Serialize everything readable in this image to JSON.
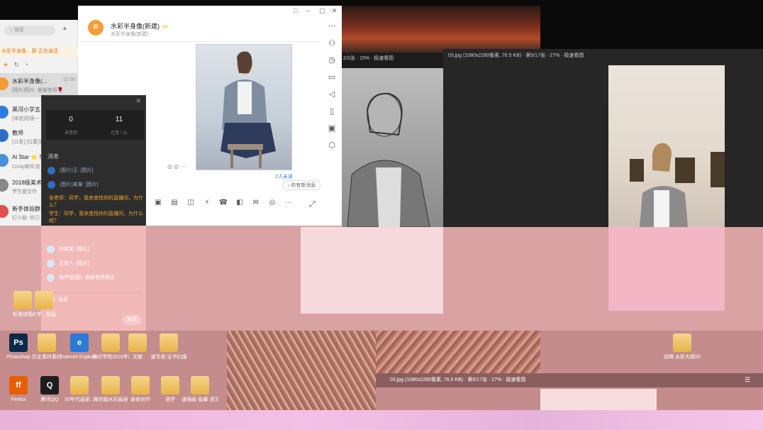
{
  "chat_list": {
    "search_placeholder": "搜索",
    "add_label": "+",
    "notice": "水彩半身像... 群 正在通话",
    "items": [
      {
        "name": "水彩半身像(...",
        "badge": "VIP",
        "message": "[图片]图片: 谢谢老师🌹",
        "time": "11:06",
        "color": "#f29d38"
      },
      {
        "name": "黑河小学五",
        "message": "[体验]班级一",
        "time": "",
        "color": "#2d7be0"
      },
      {
        "name": "教师",
        "message": "[11条] [位置]班",
        "time": "",
        "color": "#2d6dc4"
      },
      {
        "name": "Ai Star ⭐ S",
        "message": "Cindy邮件测",
        "time": "",
        "color": "#4a90d9"
      },
      {
        "name": "2018级美术",
        "message": "学生提交作",
        "time": "",
        "color": "#888888"
      },
      {
        "name": "新手体验群",
        "message": "钉小秘: 你已",
        "time": "",
        "color": "#e05050"
      }
    ]
  },
  "chat_window": {
    "group_avatar": "群",
    "group_title": "水彩半身像(新建)",
    "group_badge": "VIP",
    "group_subtitle": "水彩半身像(新建)",
    "window_controls": {
      "pin": "□",
      "minimize": "–",
      "maximize": "▢",
      "close": "✕"
    },
    "message_controls": "◎ ◎ ···",
    "unread_count": "2人未读",
    "new_message_button": "↓ 你有新消息"
  },
  "popup": {
    "close": "✕",
    "stats": [
      {
        "value": "0",
        "label": "未签到"
      },
      {
        "value": "11",
        "label": "已签 / 11"
      }
    ],
    "section_label": "消息",
    "rows": [
      {
        "name": "(图片)王: [图片]"
      },
      {
        "name": "(图片)某某: [图片]"
      }
    ],
    "warnings": [
      "张老师：同学，我来查找你的直播间，为什么？",
      "学生：同学，我来查找你的直播间，为什么呢？"
    ],
    "pink_rows": [
      {
        "name": "刘某某: [图片]"
      },
      {
        "name": "主持人: [图片]"
      },
      {
        "name": "同学(回复): 谢谢老师指点"
      }
    ],
    "reply_placeholder": "回复: 消息",
    "send_button": "发送"
  },
  "viewer1": {
    "title": "2/2张 · 15% · 极速看图",
    "filename": "",
    "zoom": "15%"
  },
  "viewer2": {
    "title": "03.jpg (1080x2280像素, 76.5 KB) · 第5/17张 · 27% · 极速看图"
  },
  "viewer3": {
    "title": "03.jpg (1080x2280像素, 76.5 KB) · 第5/17张 · 27% · 极速看图"
  },
  "desktop_icons": [
    {
      "label": "标准讲图",
      "color": "#e8b44a",
      "glyph": ""
    },
    {
      "label": "大学 · 绘画",
      "color": "#e8b44a",
      "glyph": ""
    },
    {
      "label": "Photoshop",
      "color": "#0b2a4a",
      "glyph": "Ps"
    },
    {
      "label": "历史素材素材",
      "color": "#e8b44a",
      "glyph": ""
    },
    {
      "label": "Internet Explorer",
      "color": "#2a7ad6",
      "glyph": "e"
    },
    {
      "label": "黑河学院2019年画...",
      "color": "#f0f0f0",
      "glyph": ""
    },
    {
      "label": "文献",
      "color": "#e8b44a",
      "glyph": ""
    },
    {
      "label": "速写册 证书扫描",
      "color": "#e8b44a",
      "glyph": ""
    },
    {
      "label": "Firefox",
      "color": "#e66000",
      "glyph": "ff"
    },
    {
      "label": "腾讯QQ",
      "color": "#1d1d1d",
      "glyph": "Q"
    },
    {
      "label": "50年代画家...",
      "color": "#a070d0",
      "glyph": ""
    },
    {
      "label": "微信版水彩画册",
      "color": "#7fb0e0",
      "glyph": ""
    },
    {
      "label": "装修创作",
      "color": "#e8b44a",
      "glyph": ""
    },
    {
      "label": "语学",
      "color": "#e8b44a",
      "glyph": ""
    },
    {
      "label": "速描画·临摹 语文作业",
      "color": "#e8b44a",
      "glyph": ""
    },
    {
      "label": "胡琳 水彩大纲2020.01...",
      "color": "#e8b44a",
      "glyph": ""
    }
  ],
  "toolbar_icons": [
    "☺",
    "▣",
    "▤",
    "◫",
    "⚡",
    "☎",
    "◧",
    "✉",
    "◎",
    "···"
  ],
  "rightbar_icons": [
    "⋯",
    "⚇",
    "◷",
    "▭",
    "◁",
    "▯",
    "▣",
    "⬡"
  ]
}
